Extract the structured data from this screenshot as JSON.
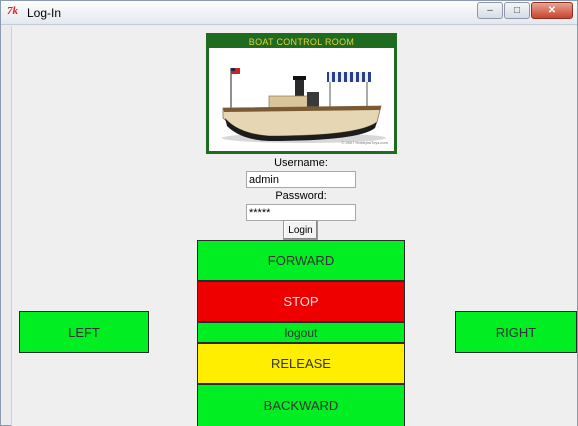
{
  "window": {
    "title": "Log-In",
    "app_icon": "tk-feather-icon",
    "logo_text": "7k",
    "controls": {
      "minimize": "–",
      "maximize": "□",
      "close": "✕"
    }
  },
  "banner": {
    "title": "BOAT CONTROL ROOM",
    "copyright": "© 2007 HobbyistToys.com"
  },
  "login": {
    "username_label": "Username:",
    "username_value": "admin",
    "password_label": "Password:",
    "password_value": "*****",
    "login_label": "Login"
  },
  "controls": {
    "forward": "FORWARD",
    "stop": "STOP",
    "logout": "logout",
    "release": "RELEASE",
    "backward": "BACKWARD",
    "left": "LEFT",
    "right": "RIGHT"
  },
  "colors": {
    "green": "#00ee22",
    "red": "#ee0000",
    "yellow": "#ffee00",
    "banner_green": "#1f6b1f"
  }
}
